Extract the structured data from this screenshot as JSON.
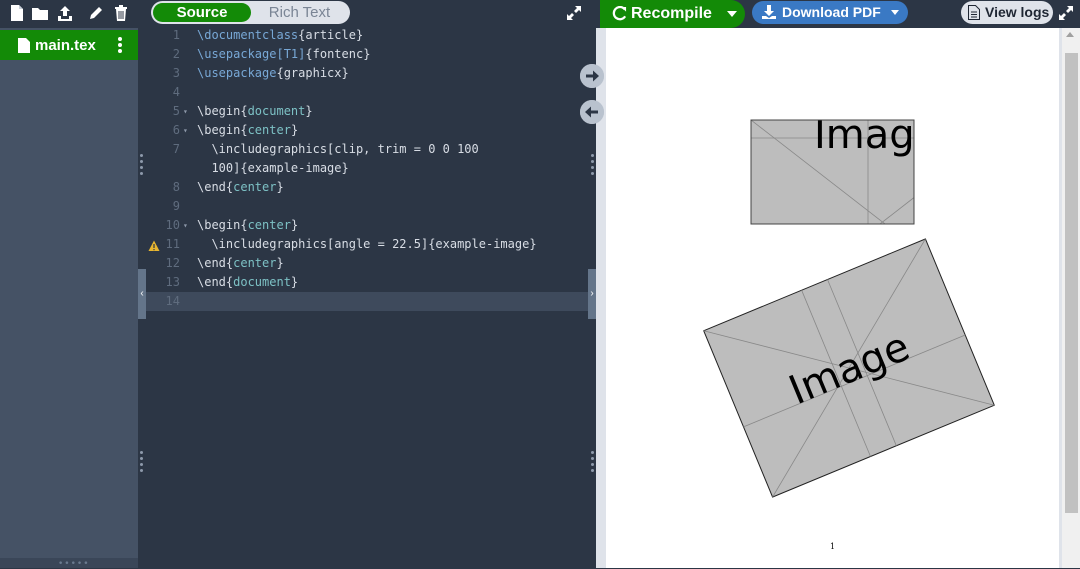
{
  "filetree": {
    "toolbar_icons": [
      "new-file-icon",
      "new-folder-icon",
      "upload-icon",
      "rename-icon",
      "delete-icon"
    ],
    "file": {
      "name": "main.tex",
      "icon": "file-icon",
      "menu_icon": "kebab-menu-icon"
    }
  },
  "editor": {
    "tabs": {
      "source": "Source",
      "rich_text": "Rich Text"
    },
    "lines": [
      {
        "n": "1",
        "fold": "",
        "parts": [
          [
            "kw",
            "\\documentclass"
          ],
          [
            "txt",
            "{article}"
          ]
        ]
      },
      {
        "n": "2",
        "fold": "",
        "parts": [
          [
            "kw",
            "\\usepackage"
          ],
          [
            "kw",
            "[T1]"
          ],
          [
            "txt",
            "{fontenc}"
          ]
        ]
      },
      {
        "n": "3",
        "fold": "",
        "parts": [
          [
            "kw",
            "\\usepackage"
          ],
          [
            "txt",
            "{graphicx}"
          ]
        ]
      },
      {
        "n": "4",
        "fold": "",
        "parts": []
      },
      {
        "n": "5",
        "fold": "▾",
        "parts": [
          [
            "txt",
            "\\begin{"
          ],
          [
            "arg",
            "document"
          ],
          [
            "txt",
            "}"
          ]
        ]
      },
      {
        "n": "6",
        "fold": "▾",
        "parts": [
          [
            "txt",
            "\\begin{"
          ],
          [
            "arg",
            "center"
          ],
          [
            "txt",
            "}"
          ]
        ]
      },
      {
        "n": "7",
        "fold": "",
        "parts": [
          [
            "txt",
            "  \\includegraphics[clip, trim = 0 0 100"
          ]
        ]
      },
      {
        "n": "",
        "fold": "",
        "parts": [
          [
            "txt",
            "  100]{example-image}"
          ]
        ]
      },
      {
        "n": "8",
        "fold": "",
        "parts": [
          [
            "txt",
            "\\end{"
          ],
          [
            "arg",
            "center"
          ],
          [
            "txt",
            "}"
          ]
        ]
      },
      {
        "n": "9",
        "fold": "",
        "parts": []
      },
      {
        "n": "10",
        "fold": "▾",
        "parts": [
          [
            "txt",
            "\\begin{"
          ],
          [
            "arg",
            "center"
          ],
          [
            "txt",
            "}"
          ]
        ]
      },
      {
        "n": "11",
        "fold": "",
        "parts": [
          [
            "txt",
            "  \\includegraphics[angle = 22.5]{example-image}"
          ]
        ]
      },
      {
        "n": "12",
        "fold": "",
        "parts": [
          [
            "txt",
            "\\end{"
          ],
          [
            "arg",
            "center"
          ],
          [
            "txt",
            "}"
          ]
        ]
      },
      {
        "n": "13",
        "fold": "",
        "parts": [
          [
            "txt",
            "\\end{"
          ],
          [
            "arg",
            "document"
          ],
          [
            "txt",
            "}"
          ]
        ]
      },
      {
        "n": "14",
        "fold": "",
        "parts": []
      }
    ],
    "warning_line": "11",
    "active_line": "14"
  },
  "pdf_toolbar": {
    "recompile": "Recompile",
    "download": "Download PDF",
    "view_logs": "View logs"
  },
  "pdf": {
    "image_label_1": "Image",
    "image_label_2": "Image",
    "page_number": "1"
  },
  "colors": {
    "accent_green": "#138a07",
    "accent_blue": "#3a79c4",
    "editor_bg": "#2c3645",
    "panel_bg": "#455265"
  }
}
